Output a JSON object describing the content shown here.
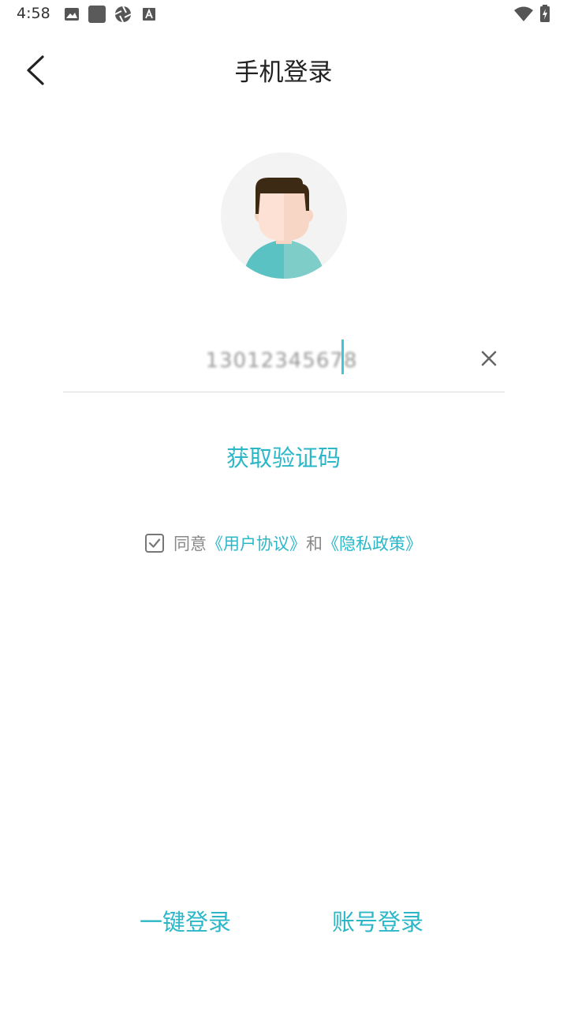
{
  "status_bar": {
    "time": "4:58"
  },
  "header": {
    "title": "手机登录"
  },
  "phone": {
    "value": "13012345678"
  },
  "actions": {
    "get_code": "获取验证码"
  },
  "agreement": {
    "prefix": "同意",
    "user_agreement": "《用户协议》",
    "conjunction": "和",
    "privacy_policy": "《隐私政策》",
    "checked": true
  },
  "bottom": {
    "one_click_login": "一键登录",
    "account_login": "账号登录"
  },
  "colors": {
    "accent": "#2bb7c8",
    "text_dark": "#222222",
    "text_muted": "#888888",
    "divider": "#dcdcdc"
  }
}
